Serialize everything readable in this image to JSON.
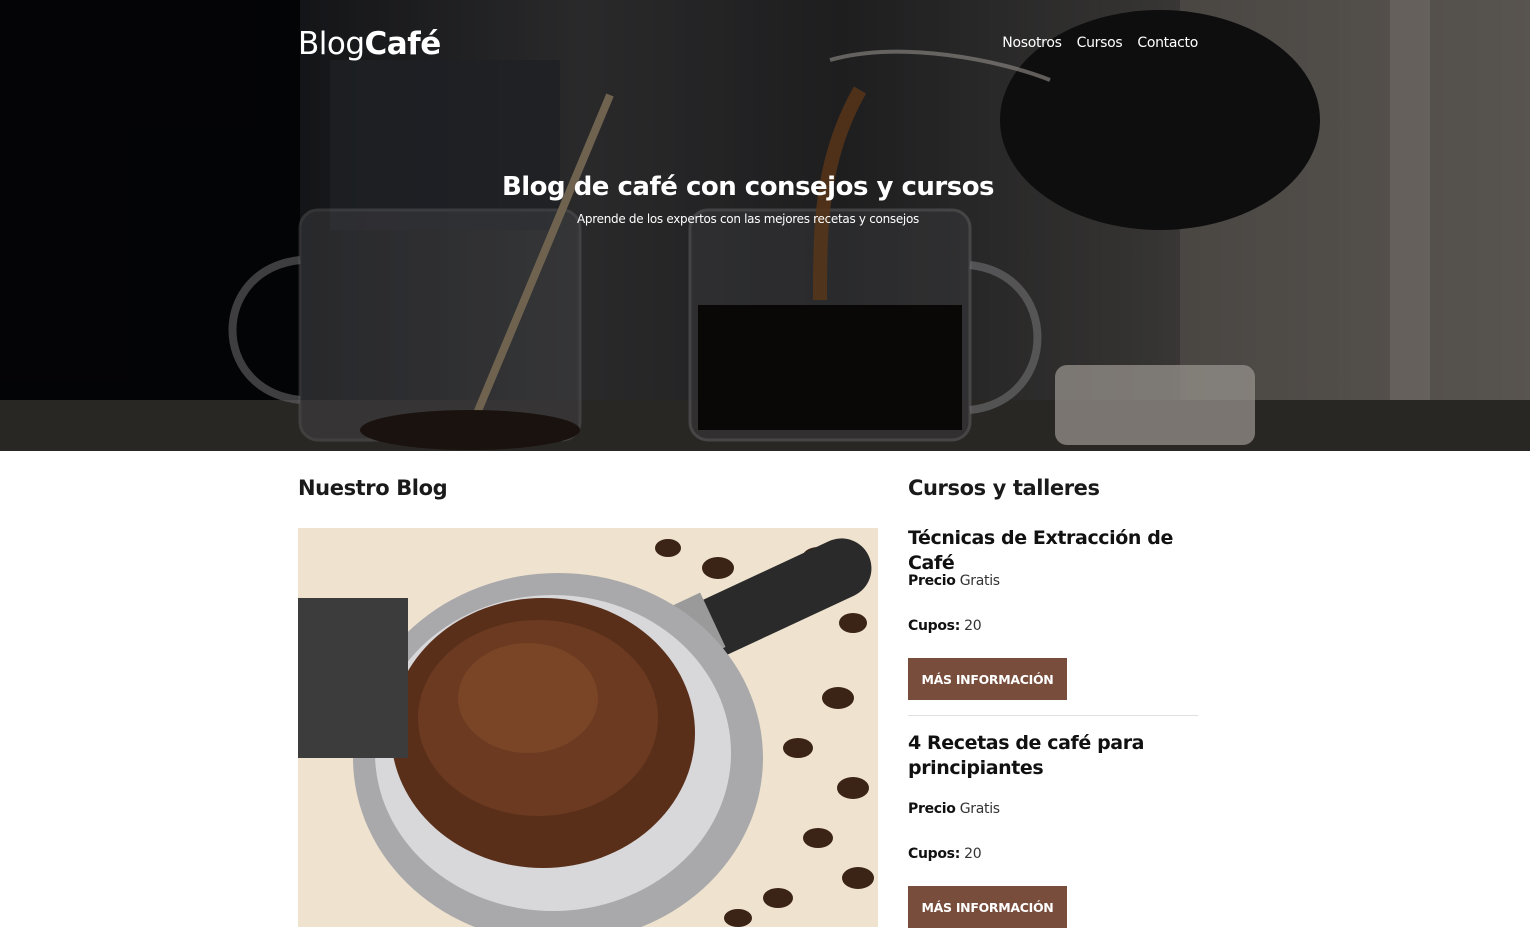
{
  "header": {
    "logo": {
      "light": "Blog",
      "bold": "Café"
    },
    "nav": [
      {
        "label": "Nosotros"
      },
      {
        "label": "Cursos"
      },
      {
        "label": "Contacto"
      }
    ]
  },
  "hero": {
    "title": "Blog de café con consejos y cursos",
    "subtitle": "Aprende de los expertos con las mejores recetas y consejos"
  },
  "blog": {
    "heading": "Nuestro Blog"
  },
  "courses": {
    "heading": "Cursos y talleres",
    "items": [
      {
        "name": "Técnicas de Extracción de Café",
        "price_label": "Precio",
        "price_value": "Gratis",
        "slots_label": "Cupos:",
        "slots_value": "20",
        "button": "MÁS INFORMACIÓN"
      },
      {
        "name": "4 Recetas de café para principiantes",
        "price_label": "Precio",
        "price_value": "Gratis",
        "slots_label": "Cupos:",
        "slots_value": "20",
        "button": "MÁS INFORMACIÓN"
      }
    ]
  },
  "colors": {
    "button_bg": "#784d3c",
    "hero_overlay": "#000000"
  }
}
